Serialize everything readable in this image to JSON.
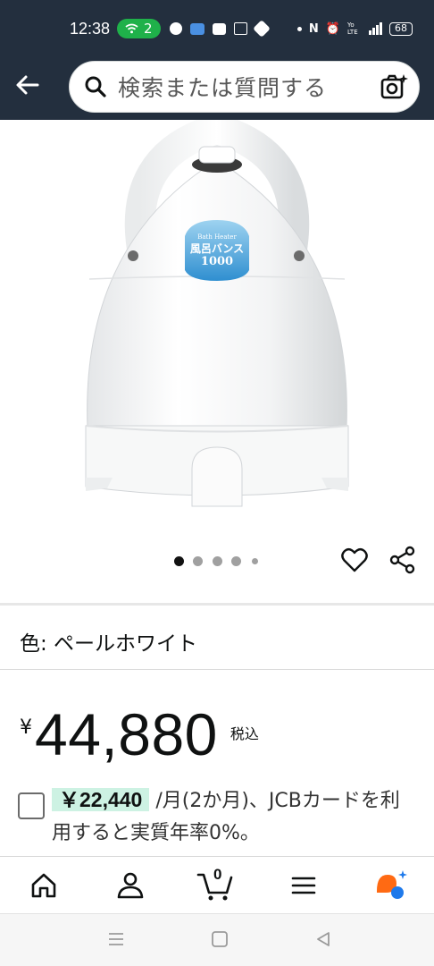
{
  "status_bar": {
    "time": "12:38",
    "wifi_count": "2",
    "battery": "68",
    "network": "4G",
    "volte": "Yo LTE"
  },
  "header": {
    "search_placeholder": "検索または質問する"
  },
  "product": {
    "label_line1": "Bath Heater",
    "label_line2": "風呂バンス",
    "label_line3": "1000",
    "image_count": 5,
    "active_image": 1
  },
  "variant": {
    "label": "色: ペールホワイト"
  },
  "price": {
    "currency": "¥",
    "amount": "44,880",
    "tax_note": "税込"
  },
  "promo": {
    "highlight": "￥22,440",
    "text_after": " /月(2か月)、JCBカードを利用すると実質年率0%。"
  },
  "colors": {
    "header_bg": "#232f3e",
    "wifi_green": "#1fb14a",
    "highlight_bg": "#cdf2e3"
  },
  "icons": {
    "back": "back-arrow-icon",
    "search": "search-icon",
    "camera": "camera-search-icon",
    "heart": "heart-icon",
    "share": "share-icon",
    "home": "home-icon",
    "account": "account-icon",
    "cart": "cart-icon",
    "menu": "menu-icon",
    "assistant": "rufus-assistant-icon"
  },
  "cart_count": "0"
}
